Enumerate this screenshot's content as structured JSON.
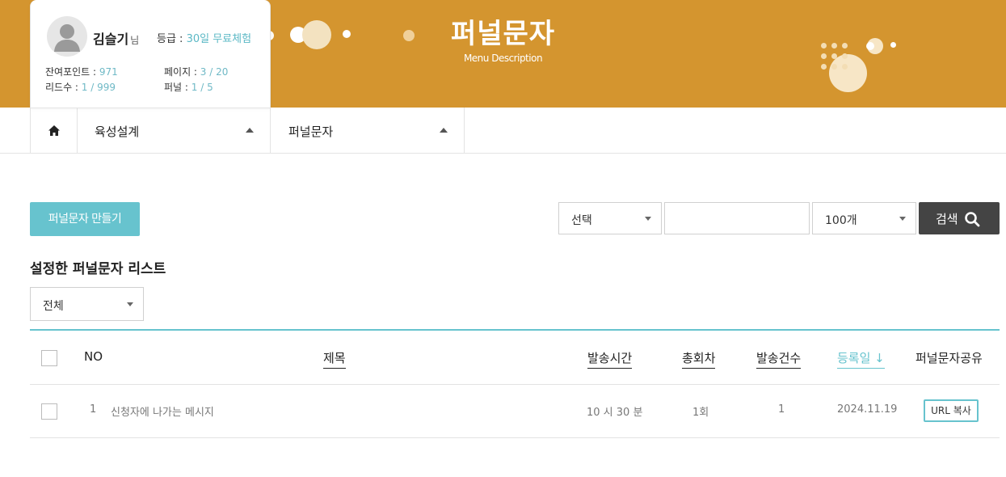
{
  "banner": {
    "title": "퍼널문자",
    "subtitle": "Menu Description"
  },
  "profile": {
    "avatar_icon": "user-avatar-icon",
    "name": "김슬기",
    "name_suffix": "님",
    "grade_label": "등급 : ",
    "grade_value": "30일 무료체험",
    "points_label": "잔여포인트 : ",
    "points_value": "971",
    "pages_label": "페이지 : ",
    "pages_value": "3 / 20",
    "leads_label": "리드수 : ",
    "leads_value": "1 / 999",
    "funnels_label": "퍼널 : ",
    "funnels_value": "1 / 5"
  },
  "nav": {
    "home_icon": "home-icon",
    "items": [
      {
        "label": "육성설계"
      },
      {
        "label": "퍼널문자"
      }
    ]
  },
  "toolbar": {
    "create_button": "퍼널문자 만들기",
    "filter_select": "선택",
    "search_value": "",
    "page_size_select": "100개",
    "search_button": "검색"
  },
  "list": {
    "title": "설정한 퍼널문자 리스트",
    "category_select": "전체",
    "columns": [
      "NO",
      "제목",
      "발송시간",
      "총회차",
      "발송건수",
      "등록일 ↓",
      "퍼널문자공유"
    ],
    "rows": [
      {
        "no": "1",
        "title": "신청자에 나가는 메시지",
        "send_time": "10 시 30 분",
        "rounds": "1회",
        "count": "1",
        "date": "2024.11.19",
        "share_button": "URL 복사"
      }
    ]
  },
  "colors": {
    "banner": "#D4952F",
    "accent": "#67C3CE",
    "search_button": "#444444"
  }
}
